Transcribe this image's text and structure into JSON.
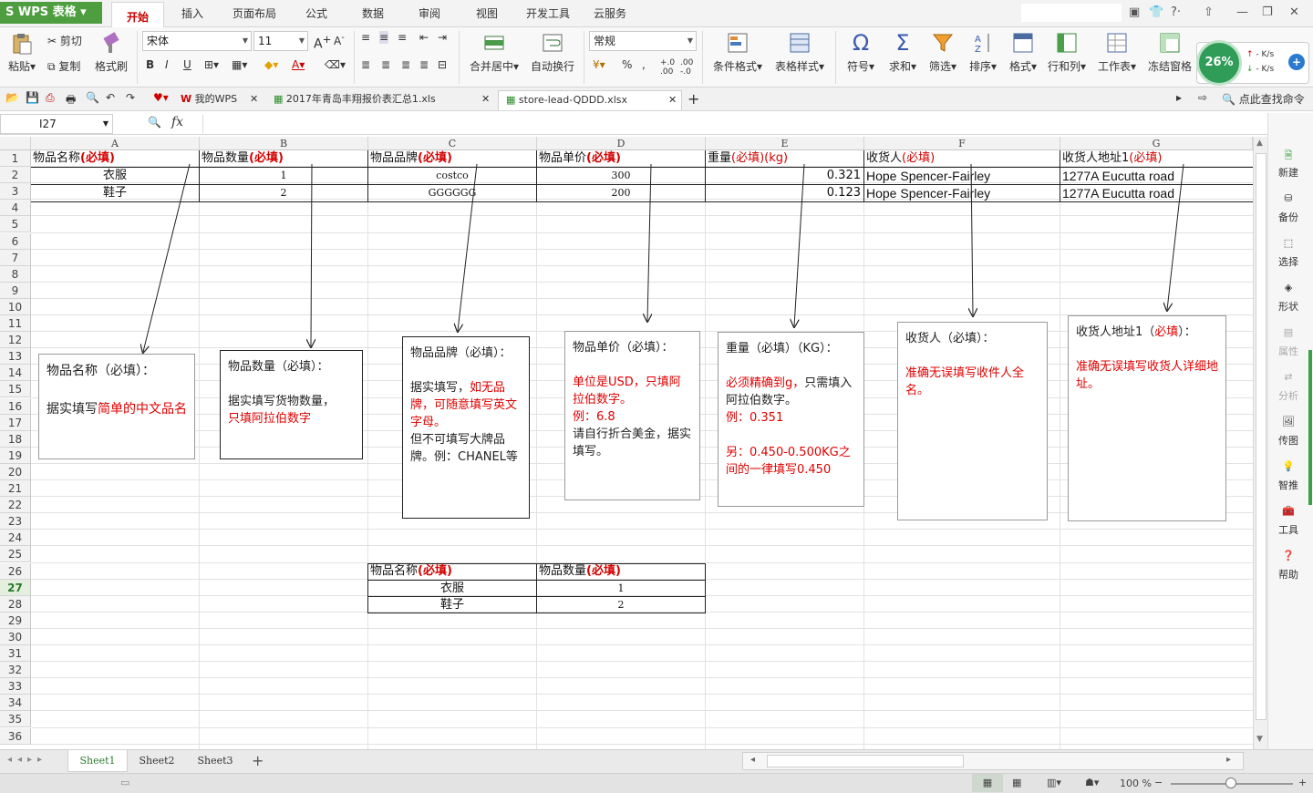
{
  "menubar": {
    "app_name": "WPS 表格",
    "tabs": [
      "开始",
      "插入",
      "页面布局",
      "公式",
      "数据",
      "审阅",
      "视图",
      "开发工具",
      "云服务"
    ]
  },
  "ribbon": {
    "paste": "粘贴",
    "cut": "剪切",
    "copy": "复制",
    "format_painter": "格式刷",
    "font_name": "宋体",
    "font_size": "11",
    "merge_center": "合并居中",
    "wrap_text": "自动换行",
    "number_format": "常规",
    "conditional_format": "条件格式",
    "table_style": "表格样式",
    "symbol": "符号",
    "sum": "求和",
    "filter": "筛选",
    "sort": "排序",
    "format": "格式",
    "row_col": "行和列",
    "worksheet": "工作表",
    "freeze": "冻结窗格",
    "speed_percent": "26%",
    "speed_up": "- K/s",
    "speed_down": "- K/s"
  },
  "doc_tabs": [
    {
      "label": "我的WPS"
    },
    {
      "label": "2017年青岛丰翔报价表汇总1.xls"
    },
    {
      "label": "store-lead-QDDD.xlsx"
    }
  ],
  "search_command": "点此查找命令",
  "formula_bar": {
    "cell_ref": "I27",
    "fx": "fx",
    "value": ""
  },
  "columns": [
    "A",
    "B",
    "C",
    "D",
    "E",
    "F",
    "G"
  ],
  "rows": [
    "1",
    "2",
    "3",
    "4",
    "5",
    "6",
    "7",
    "8",
    "9",
    "10",
    "11",
    "12",
    "13",
    "14",
    "15",
    "16",
    "17",
    "18",
    "19",
    "20",
    "21",
    "22",
    "23",
    "24",
    "25",
    "26",
    "27",
    "28",
    "29",
    "30",
    "31",
    "32",
    "33",
    "34",
    "35",
    "36"
  ],
  "sheet": {
    "header": {
      "a": "物品名称",
      "b": "物品数量",
      "c": "物品品牌",
      "d": "物品单价",
      "e_pre": "重量",
      "e_req": "(必填)",
      "e_unit": "(kg)",
      "f_pre": "收货人",
      "f_req": "(必填)",
      "g_pre": "收货人地址1",
      "g_req": "(必填)",
      "req": "(必填)"
    },
    "row2": {
      "a": "衣服",
      "b": "1",
      "c": "costco",
      "d": "300",
      "e": "0.321",
      "f": "Hope Spencer-Fairley",
      "g": "1277A Eucutta road"
    },
    "row3": {
      "a": "鞋子",
      "b": "2",
      "c": "GGGGGG",
      "d": "200",
      "e": "0.123",
      "f": "Hope Spencer-Fairley",
      "g": "1277A Eucutta road"
    },
    "small_table": {
      "h1": "物品名称",
      "h2": "物品数量",
      "req": "(必填)",
      "r1a": "衣服",
      "r1b": "1",
      "r2a": "鞋子",
      "r2b": "2"
    }
  },
  "notes": {
    "a": {
      "title": "物品名称（必填）：",
      "body1": "据实填写",
      "body2": "简单的中文品名"
    },
    "b": {
      "title": "物品数量（必填）：",
      "body1": "据实填写货物数量，",
      "body2": "只填阿拉伯数字"
    },
    "c": {
      "title": "物品品牌（必填）：",
      "body1": "据实填写，",
      "body2": "如无品牌，可随意填写英文字母。",
      "body3": "但不可填写大牌品牌。例：CHANEL等"
    },
    "d": {
      "title": "物品单价（必填）：",
      "body1": "单位是USD，只填阿拉伯数字。\n例：6.8",
      "body2": "请自行折合美金，据实填写。"
    },
    "e": {
      "title": "重量（必填）（KG）：",
      "body1": "必须精确到g，",
      "body2": "只需填入阿拉伯数字。",
      "body3": "例：0.351",
      "body4": "另：0.450-0.500KG之间的一律填写0.450"
    },
    "f": {
      "title": "收货人（必填）：",
      "body1": "准确无误填写收件人全名。"
    },
    "g": {
      "title_pre": "收货人地址1（",
      "title_req": "必填",
      "title_post": "）：",
      "body1": "准确无误填写收货人详细地址。"
    }
  },
  "right_panel": [
    "新建",
    "备份",
    "选择",
    "形状",
    "属性",
    "分析",
    "传图",
    "智推",
    "工具",
    "帮助"
  ],
  "sheet_tabs": [
    "Sheet1",
    "Sheet2",
    "Sheet3"
  ],
  "status": {
    "zoom": "100 %"
  }
}
